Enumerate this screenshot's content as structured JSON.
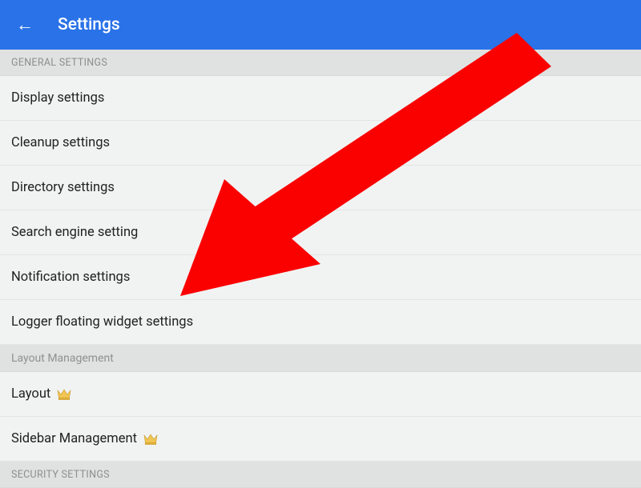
{
  "header": {
    "title": "Settings",
    "back_icon": "←"
  },
  "sections": {
    "general": {
      "label": "GENERAL SETTINGS",
      "items": [
        "Display settings",
        "Cleanup settings",
        "Directory settings",
        "Search engine setting",
        "Notification settings",
        "Logger floating widget settings"
      ]
    },
    "layout": {
      "label": "Layout Management",
      "items": [
        "Layout",
        "Sidebar Management"
      ]
    },
    "security": {
      "label": "SECURITY SETTINGS"
    }
  },
  "annotation": {
    "color": "#fa0100"
  }
}
